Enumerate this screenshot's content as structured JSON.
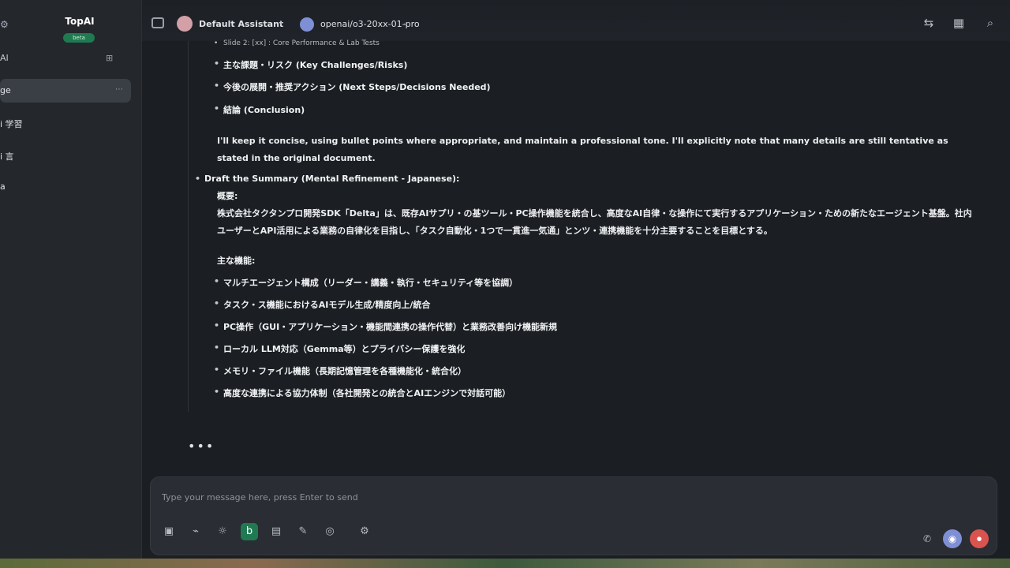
{
  "sidebar": {
    "brand": "TopAI",
    "brand_badge": "beta",
    "section_label": "AI",
    "items": [
      {
        "label": "ge",
        "active": true
      },
      {
        "label": "i 学習"
      },
      {
        "label": "i 言"
      },
      {
        "label": "a"
      }
    ]
  },
  "topbar": {
    "agent_name": "Default Assistant",
    "model_name": "openai/o3-20xx-01-pro"
  },
  "message": {
    "top_partial": "Slide 2: [xx] : Core Performance & Lab Tests",
    "bullets_top": [
      "主な課題・リスク (Key Challenges/Risks)",
      "今後の展開・推奨アクション (Next Steps/Decisions Needed)",
      "結論 (Conclusion)"
    ],
    "plan_text": "I'll keep it concise, using bullet points where appropriate, and maintain a professional tone. I'll explicitly note that many details are still tentative as stated in the original document.",
    "step_title": "Draft the Summary (Mental Refinement - Japanese):",
    "overview_label": "概要:",
    "overview_text": "株式会社タクタンプロ開発SDK「Delta」は、既存AIサプリ・の基ツール・PC操作機能を統合し、高度なAI自律・な操作にて実行するアプリケーション・ための新たなエージェント基盤。社内ユーザーとAPI活用による業務の自律化を目指し、「タスク自動化・1つで一貫進一気通」とンツ・連携機能を十分主要することを目標とする。",
    "features_label": "主な機能:",
    "features": [
      "マルチエージェント構成（リーダー・講義・執行・セキュリティ等を協調）",
      "タスク・ス機能におけるAIモデル生成/精度向上/統合",
      "PC操作（GUI・アプリケーション・機能間連携の操作代替）と業務改善向け機能新規",
      "ローカル LLM対応（Gemma等）とプライバシー保護を強化",
      "メモリ・ファイル機能（長期記憶管理を各種機能化・統合化）",
      "高度な連携による協力体制（各社開発との統合とAIエンジンで対話可能）"
    ],
    "typing_indicator": "•••"
  },
  "composer": {
    "placeholder": "Type your message here, press Enter to send"
  },
  "colors": {
    "accent_green": "#1f7a52",
    "send_red": "#d9534f",
    "model_purple": "#7f8fd6"
  },
  "icons": {
    "tools": [
      "image-icon",
      "attach-icon",
      "lightbulb-icon",
      "web-search-icon",
      "file-icon",
      "tools-icon",
      "mcp-icon",
      "settings-icon"
    ],
    "right": [
      "phone-icon",
      "assistant-icon",
      "send-icon"
    ]
  }
}
